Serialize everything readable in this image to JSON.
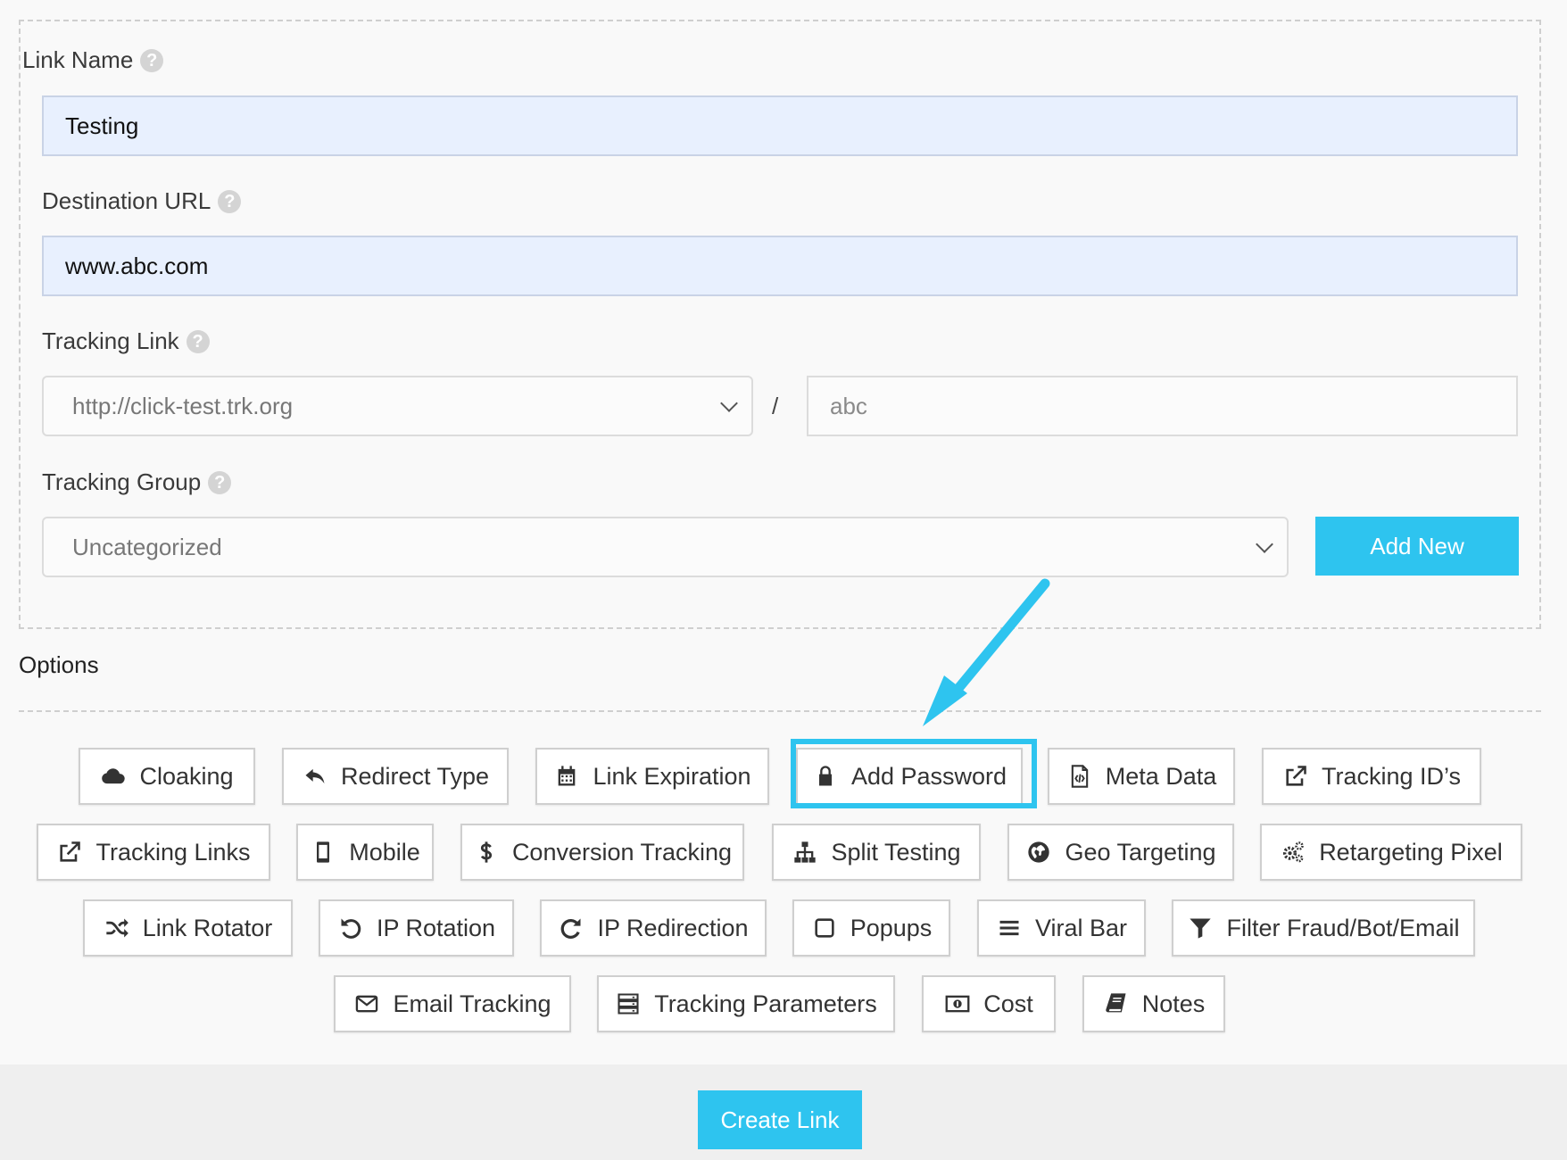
{
  "form": {
    "link_name_label": "Link Name",
    "link_name_value": "Testing",
    "destination_label": "Destination URL",
    "destination_value": "www.abc.com",
    "tracking_link_label": "Tracking Link",
    "tracking_domain": "http://click-test.trk.org",
    "slash": "/",
    "tracking_slug": "abc",
    "tracking_group_label": "Tracking Group",
    "tracking_group_value": "Uncategorized",
    "add_new_label": "Add New",
    "help_glyph": "?"
  },
  "options": {
    "title": "Options",
    "buttons": [
      {
        "label": "Cloaking",
        "icon": "cloud-icon"
      },
      {
        "label": "Redirect Type",
        "icon": "reply-icon"
      },
      {
        "label": "Link Expiration",
        "icon": "calendar-icon"
      },
      {
        "label": "Add Password",
        "icon": "lock-icon"
      },
      {
        "label": "Meta Data",
        "icon": "code-file-icon"
      },
      {
        "label": "Tracking ID’s",
        "icon": "external-link-icon"
      },
      {
        "label": "Tracking Links",
        "icon": "external-link-icon"
      },
      {
        "label": "Mobile",
        "icon": "mobile-icon"
      },
      {
        "label": "Conversion Tracking",
        "icon": "dollar-icon"
      },
      {
        "label": "Split Testing",
        "icon": "sitemap-icon"
      },
      {
        "label": "Geo Targeting",
        "icon": "globe-icon"
      },
      {
        "label": "Retargeting Pixel",
        "icon": "gears-icon"
      },
      {
        "label": "Link Rotator",
        "icon": "shuffle-icon"
      },
      {
        "label": "IP Rotation",
        "icon": "undo-icon"
      },
      {
        "label": "IP Redirection",
        "icon": "redo-icon"
      },
      {
        "label": "Popups",
        "icon": "square-icon"
      },
      {
        "label": "Viral Bar",
        "icon": "bars-icon"
      },
      {
        "label": "Filter Fraud/Bot/Email",
        "icon": "filter-icon"
      },
      {
        "label": "Email Tracking",
        "icon": "envelope-icon"
      },
      {
        "label": "Tracking Parameters",
        "icon": "server-icon"
      },
      {
        "label": "Cost",
        "icon": "money-icon"
      },
      {
        "label": "Notes",
        "icon": "book-icon"
      }
    ]
  },
  "footer": {
    "create_link_label": "Create Link"
  },
  "colors": {
    "accent": "#2ec4ef",
    "input_fill": "#e8f0fe"
  }
}
